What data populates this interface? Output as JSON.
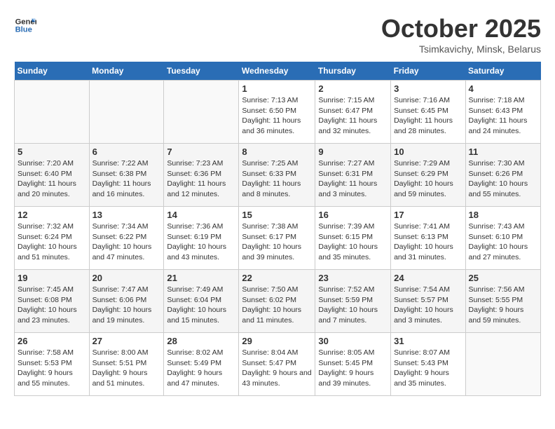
{
  "header": {
    "logo_line1": "General",
    "logo_line2": "Blue",
    "month": "October 2025",
    "location": "Tsimkavichy, Minsk, Belarus"
  },
  "days_of_week": [
    "Sunday",
    "Monday",
    "Tuesday",
    "Wednesday",
    "Thursday",
    "Friday",
    "Saturday"
  ],
  "weeks": [
    [
      {
        "day": "",
        "info": ""
      },
      {
        "day": "",
        "info": ""
      },
      {
        "day": "",
        "info": ""
      },
      {
        "day": "1",
        "info": "Sunrise: 7:13 AM\nSunset: 6:50 PM\nDaylight: 11 hours and 36 minutes."
      },
      {
        "day": "2",
        "info": "Sunrise: 7:15 AM\nSunset: 6:47 PM\nDaylight: 11 hours and 32 minutes."
      },
      {
        "day": "3",
        "info": "Sunrise: 7:16 AM\nSunset: 6:45 PM\nDaylight: 11 hours and 28 minutes."
      },
      {
        "day": "4",
        "info": "Sunrise: 7:18 AM\nSunset: 6:43 PM\nDaylight: 11 hours and 24 minutes."
      }
    ],
    [
      {
        "day": "5",
        "info": "Sunrise: 7:20 AM\nSunset: 6:40 PM\nDaylight: 11 hours and 20 minutes."
      },
      {
        "day": "6",
        "info": "Sunrise: 7:22 AM\nSunset: 6:38 PM\nDaylight: 11 hours and 16 minutes."
      },
      {
        "day": "7",
        "info": "Sunrise: 7:23 AM\nSunset: 6:36 PM\nDaylight: 11 hours and 12 minutes."
      },
      {
        "day": "8",
        "info": "Sunrise: 7:25 AM\nSunset: 6:33 PM\nDaylight: 11 hours and 8 minutes."
      },
      {
        "day": "9",
        "info": "Sunrise: 7:27 AM\nSunset: 6:31 PM\nDaylight: 11 hours and 3 minutes."
      },
      {
        "day": "10",
        "info": "Sunrise: 7:29 AM\nSunset: 6:29 PM\nDaylight: 10 hours and 59 minutes."
      },
      {
        "day": "11",
        "info": "Sunrise: 7:30 AM\nSunset: 6:26 PM\nDaylight: 10 hours and 55 minutes."
      }
    ],
    [
      {
        "day": "12",
        "info": "Sunrise: 7:32 AM\nSunset: 6:24 PM\nDaylight: 10 hours and 51 minutes."
      },
      {
        "day": "13",
        "info": "Sunrise: 7:34 AM\nSunset: 6:22 PM\nDaylight: 10 hours and 47 minutes."
      },
      {
        "day": "14",
        "info": "Sunrise: 7:36 AM\nSunset: 6:19 PM\nDaylight: 10 hours and 43 minutes."
      },
      {
        "day": "15",
        "info": "Sunrise: 7:38 AM\nSunset: 6:17 PM\nDaylight: 10 hours and 39 minutes."
      },
      {
        "day": "16",
        "info": "Sunrise: 7:39 AM\nSunset: 6:15 PM\nDaylight: 10 hours and 35 minutes."
      },
      {
        "day": "17",
        "info": "Sunrise: 7:41 AM\nSunset: 6:13 PM\nDaylight: 10 hours and 31 minutes."
      },
      {
        "day": "18",
        "info": "Sunrise: 7:43 AM\nSunset: 6:10 PM\nDaylight: 10 hours and 27 minutes."
      }
    ],
    [
      {
        "day": "19",
        "info": "Sunrise: 7:45 AM\nSunset: 6:08 PM\nDaylight: 10 hours and 23 minutes."
      },
      {
        "day": "20",
        "info": "Sunrise: 7:47 AM\nSunset: 6:06 PM\nDaylight: 10 hours and 19 minutes."
      },
      {
        "day": "21",
        "info": "Sunrise: 7:49 AM\nSunset: 6:04 PM\nDaylight: 10 hours and 15 minutes."
      },
      {
        "day": "22",
        "info": "Sunrise: 7:50 AM\nSunset: 6:02 PM\nDaylight: 10 hours and 11 minutes."
      },
      {
        "day": "23",
        "info": "Sunrise: 7:52 AM\nSunset: 5:59 PM\nDaylight: 10 hours and 7 minutes."
      },
      {
        "day": "24",
        "info": "Sunrise: 7:54 AM\nSunset: 5:57 PM\nDaylight: 10 hours and 3 minutes."
      },
      {
        "day": "25",
        "info": "Sunrise: 7:56 AM\nSunset: 5:55 PM\nDaylight: 9 hours and 59 minutes."
      }
    ],
    [
      {
        "day": "26",
        "info": "Sunrise: 7:58 AM\nSunset: 5:53 PM\nDaylight: 9 hours and 55 minutes."
      },
      {
        "day": "27",
        "info": "Sunrise: 8:00 AM\nSunset: 5:51 PM\nDaylight: 9 hours and 51 minutes."
      },
      {
        "day": "28",
        "info": "Sunrise: 8:02 AM\nSunset: 5:49 PM\nDaylight: 9 hours and 47 minutes."
      },
      {
        "day": "29",
        "info": "Sunrise: 8:04 AM\nSunset: 5:47 PM\nDaylight: 9 hours and 43 minutes."
      },
      {
        "day": "30",
        "info": "Sunrise: 8:05 AM\nSunset: 5:45 PM\nDaylight: 9 hours and 39 minutes."
      },
      {
        "day": "31",
        "info": "Sunrise: 8:07 AM\nSunset: 5:43 PM\nDaylight: 9 hours and 35 minutes."
      },
      {
        "day": "",
        "info": ""
      }
    ]
  ]
}
